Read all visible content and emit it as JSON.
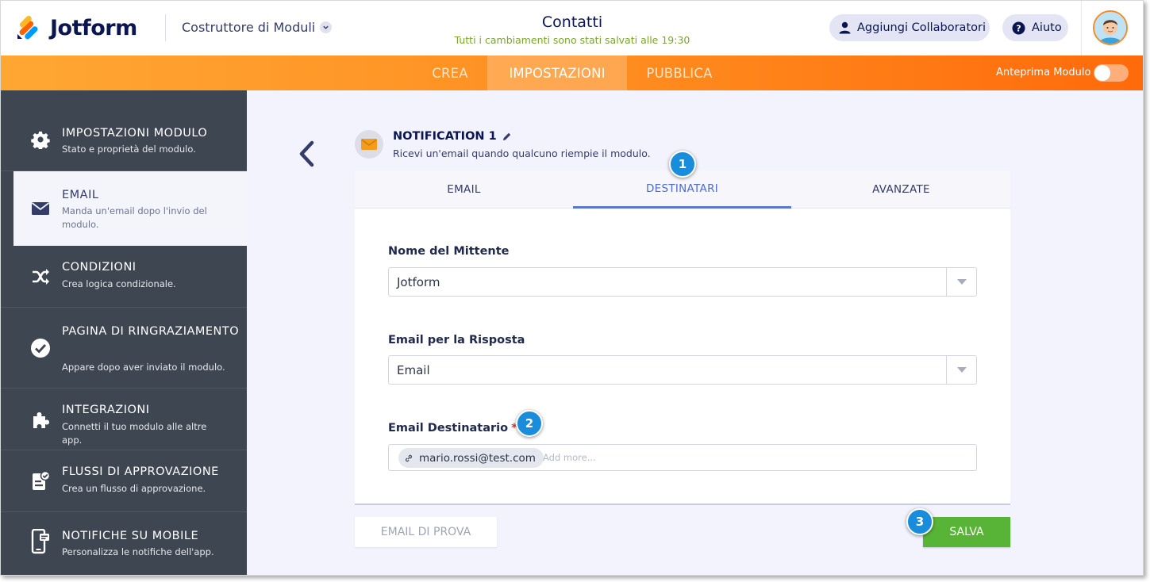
{
  "header": {
    "logo_text": "Jotform",
    "builder_label": "Costruttore di Moduli",
    "form_title": "Contatti",
    "save_status": "Tutti i cambiamenti sono stati salvati alle 19:30",
    "collab_button": "Aggiungi Collaboratori",
    "help_button": "Aiuto"
  },
  "nav": {
    "tabs": [
      "CREA",
      "IMPOSTAZIONI",
      "PUBBLICA"
    ],
    "active_tab": "IMPOSTAZIONI",
    "preview_label": "Anteprima Modulo",
    "preview_on": false
  },
  "sidebar": {
    "items": [
      {
        "title": "IMPOSTAZIONI MODULO",
        "desc": "Stato e proprietà del modulo.",
        "icon": "gear-icon"
      },
      {
        "title": "EMAIL",
        "desc": "Manda un'email dopo l'invio del modulo.",
        "icon": "envelope-icon",
        "active": true
      },
      {
        "title": "CONDIZIONI",
        "desc": "Crea logica condizionale.",
        "icon": "shuffle-icon"
      },
      {
        "title": "PAGINA DI RINGRAZIAMENTO",
        "desc": "Appare dopo aver inviato il modulo.",
        "icon": "check-circle-icon"
      },
      {
        "title": "INTEGRAZIONI",
        "desc": "Connetti il tuo modulo alle altre app.",
        "icon": "puzzle-icon"
      },
      {
        "title": "FLUSSI DI APPROVAZIONE",
        "desc": "Crea un flusso di approvazione.",
        "icon": "approval-icon"
      },
      {
        "title": "NOTIFICHE SU MOBILE",
        "desc": "Personalizza le notifiche dell'app.",
        "icon": "mobile-icon"
      }
    ]
  },
  "notification": {
    "title": "NOTIFICATION 1",
    "desc": "Ricevi un'email quando qualcuno riempie il modulo."
  },
  "panel": {
    "tabs": [
      "EMAIL",
      "DESTINATARI",
      "AVANZATE"
    ],
    "active_tab": "DESTINATARI",
    "sender_label": "Nome del Mittente",
    "sender_value": "Jotform",
    "reply_label": "Email per la Risposta",
    "reply_value": "Email",
    "recipient_label": "Email Destinatario",
    "recipient_required": "*",
    "recipient_tag": "mario.rossi@test.com",
    "recipient_placeholder": "Add more..."
  },
  "buttons": {
    "test_email": "EMAIL DI PROVA",
    "save": "SALVA"
  },
  "callouts": [
    "1",
    "2",
    "3"
  ],
  "colors": {
    "brand_orange": "#ff8c1f",
    "sidebar_bg": "#3e4652",
    "save_green": "#58b437",
    "callout_blue": "#1a8cdc",
    "active_tab_blue": "#4d6bd1",
    "required_red": "#e0313a"
  }
}
